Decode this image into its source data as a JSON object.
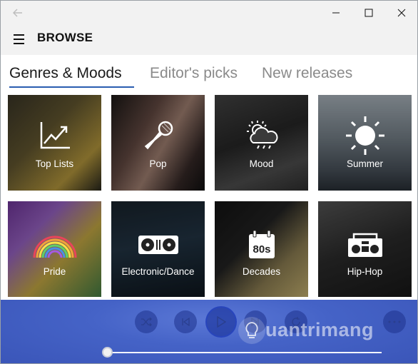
{
  "header": {
    "title": "BROWSE"
  },
  "tabs": [
    {
      "label": "Genres & Moods",
      "active": true
    },
    {
      "label": "Editor's picks",
      "active": false
    },
    {
      "label": "New releases",
      "active": false
    }
  ],
  "tiles": [
    {
      "label": "Top Lists",
      "icon": "chart-line-icon"
    },
    {
      "label": "Pop",
      "icon": "microphone-icon"
    },
    {
      "label": "Mood",
      "icon": "weather-mood-icon"
    },
    {
      "label": "Summer",
      "icon": "sun-icon"
    },
    {
      "label": "Pride",
      "icon": "rainbow-icon"
    },
    {
      "label": "Electronic/Dance",
      "icon": "turntable-icon"
    },
    {
      "label": "Decades",
      "icon": "calendar-80s-icon"
    },
    {
      "label": "Hip-Hop",
      "icon": "boombox-icon"
    }
  ],
  "player": {
    "controls": [
      "shuffle-icon",
      "previous-icon",
      "play-icon",
      "next-icon",
      "repeat-icon",
      "more-icon"
    ],
    "progress": 0,
    "accent": "#4563c7"
  },
  "watermark": {
    "text": "uantrimang",
    "icon": "lightbulb-icon"
  },
  "colors": {
    "tab_underline": "#2a5db0",
    "titlebar": "#f2f2f2"
  }
}
